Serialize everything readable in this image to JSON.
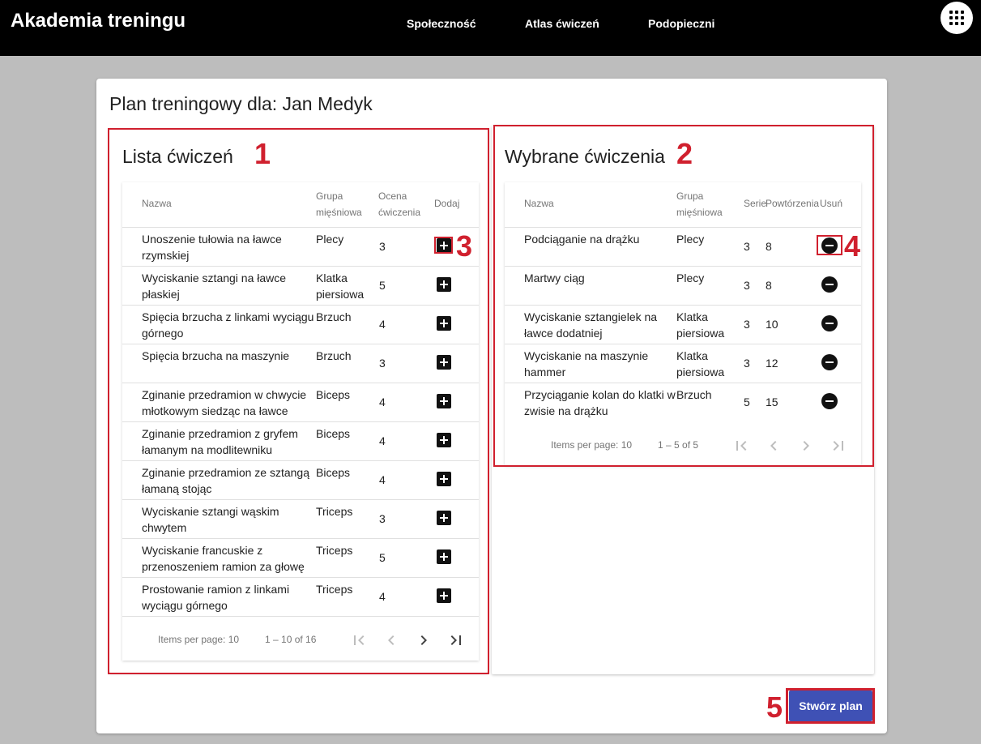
{
  "app": {
    "title": "Akademia treningu",
    "nav": [
      "Społeczność",
      "Atlas ćwiczeń",
      "Podopieczni"
    ]
  },
  "page": {
    "title": "Plan treningowy dla: Jan Medyk"
  },
  "exercise_list": {
    "title": "Lista ćwiczeń",
    "marker": "1",
    "headers": {
      "name": "Nazwa",
      "group": "Grupa mięśniowa",
      "rating": "Ocena ćwiczenia",
      "add": "Dodaj"
    },
    "rows": [
      {
        "name": "Unoszenie tułowia na ławce rzymskiej",
        "group": "Plecy",
        "rating": "3"
      },
      {
        "name": "Wyciskanie sztangi na ławce płaskiej",
        "group": "Klatka piersiowa",
        "rating": "5"
      },
      {
        "name": "Spięcia brzucha z linkami wyciągu górnego",
        "group": "Brzuch",
        "rating": "4"
      },
      {
        "name": "Spięcia brzucha na maszynie",
        "group": "Brzuch",
        "rating": "3"
      },
      {
        "name": "Zginanie przedramion w chwycie młotkowym siedząc na ławce",
        "group": "Biceps",
        "rating": "4"
      },
      {
        "name": "Zginanie przedramion z gryfem łamanym na modlitewniku",
        "group": "Biceps",
        "rating": "4"
      },
      {
        "name": "Zginanie przedramion ze sztangą łamaną stojąc",
        "group": "Biceps",
        "rating": "4"
      },
      {
        "name": "Wyciskanie sztangi wąskim chwytem",
        "group": "Triceps",
        "rating": "3"
      },
      {
        "name": "Wyciskanie francuskie z przenoszeniem ramion za głowę",
        "group": "Triceps",
        "rating": "5"
      },
      {
        "name": "Prostowanie ramion z linkami wyciągu górnego",
        "group": "Triceps",
        "rating": "4"
      }
    ],
    "pager": {
      "items_per_page": "Items per page: 10",
      "range": "1 – 10 of 16"
    },
    "add_marker": "3"
  },
  "selected_list": {
    "title": "Wybrane ćwiczenia",
    "marker": "2",
    "headers": {
      "name": "Nazwa",
      "group": "Grupa mięśniowa",
      "sets": "Serie",
      "reps": "Powtórzenia",
      "remove": "Usuń"
    },
    "rows": [
      {
        "name": "Podciąganie na drążku",
        "group": "Plecy",
        "sets": "3",
        "reps": "8"
      },
      {
        "name": "Martwy ciąg",
        "group": "Plecy",
        "sets": "3",
        "reps": "8"
      },
      {
        "name": "Wyciskanie sztangielek na ławce dodatniej",
        "group": "Klatka piersiowa",
        "sets": "3",
        "reps": "10"
      },
      {
        "name": "Wyciskanie na maszynie hammer",
        "group": "Klatka piersiowa",
        "sets": "3",
        "reps": "12"
      },
      {
        "name": "Przyciąganie kolan do klatki w zwisie na drążku",
        "group": "Brzuch",
        "sets": "5",
        "reps": "15"
      }
    ],
    "pager": {
      "items_per_page": "Items per page: 10",
      "range": "1 – 5 of 5"
    },
    "remove_marker": "4"
  },
  "actions": {
    "create_label": "Stwórz plan",
    "create_marker": "5",
    "accent": "#3f51b5"
  },
  "annotation_color": "#d0202e"
}
